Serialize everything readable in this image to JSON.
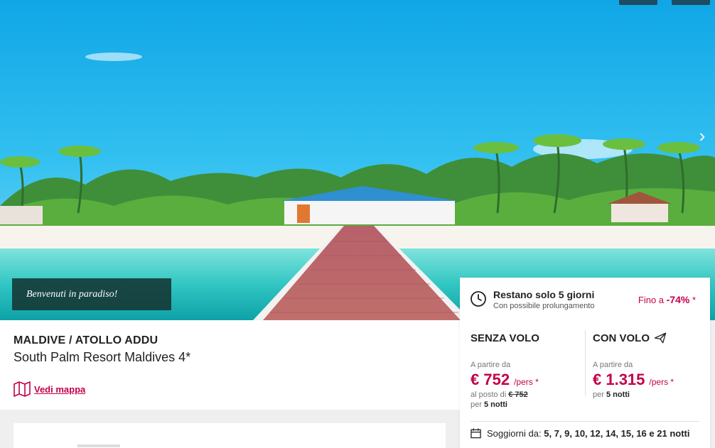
{
  "hero": {
    "welcome_text": "Benvenuti in paradiso!",
    "next_arrow": "›"
  },
  "header": {
    "destination": "MALDIVE / ATOLLO ADDU",
    "hotel_name": "South Palm Resort Maldives 4*",
    "map_link": "Vedi mappa",
    "map_icon": "map-icon"
  },
  "availability": {
    "title": "Restano solo 5 giorni",
    "subtitle": "Con possibile prolungamento",
    "discount_prefix": "Fino a ",
    "discount_value": "-74%",
    "discount_suffix": " *"
  },
  "offers": {
    "no_flight": {
      "title": "SENZA VOLO",
      "from_label": "A partire da",
      "price": "€ 752",
      "per_person": "/pers *",
      "instead_of_label": "al posto di ",
      "instead_of_price": "€ 752",
      "nights_prefix": "per ",
      "nights": "5 notti"
    },
    "with_flight": {
      "title": "CON VOLO",
      "from_label": "A partire da",
      "price": "€ 1.315",
      "per_person": "/pers *",
      "nights_prefix": "per ",
      "nights": "5 notti"
    }
  },
  "stays": {
    "label": "Soggiorni da: ",
    "values": "5, 7, 9, 10, 12, 14, 15, 16 e 21 notti"
  },
  "colors": {
    "accent": "#c3004a",
    "overlay": "#143432",
    "top_buttons": "#1f4b63"
  }
}
